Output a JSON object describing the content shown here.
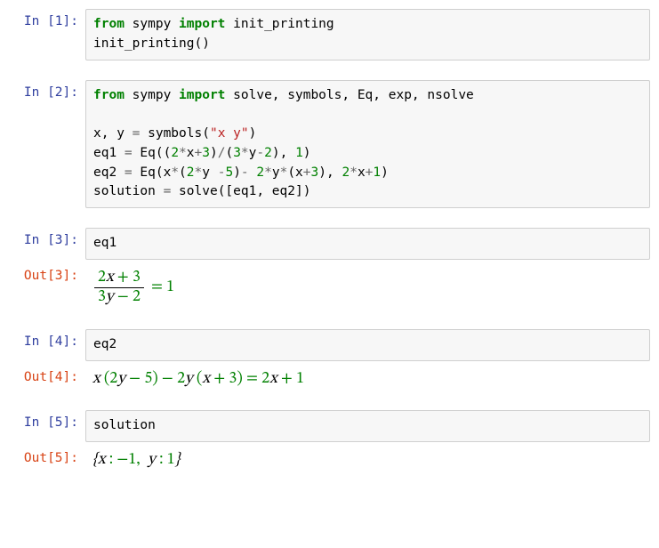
{
  "cells": [
    {
      "in_prompt": "In [1]:",
      "code": {
        "line1_from": "from",
        "line1_mod": " sympy ",
        "line1_import": "import",
        "line1_rest": " init_printing",
        "line2": "init_printing()"
      }
    },
    {
      "in_prompt": "In [2]:",
      "code": {
        "l1_from": "from",
        "l1_mod": " sympy ",
        "l1_import": "import",
        "l1_rest": " solve, symbols, Eq, exp, nsolve",
        "blank": "",
        "l3_a": "x, y ",
        "l3_eq": "=",
        "l3_b": " symbols(",
        "l3_str": "\"x y\"",
        "l3_c": ")",
        "l4_a": "eq1 ",
        "l4_eq": "=",
        "l4_b": " Eq((",
        "l4_n2a": "2",
        "l4_c": "*",
        "l4_d": "x",
        "l4_plus": "+",
        "l4_n3a": "3",
        "l4_e": ")",
        "l4_slash": "/",
        "l4_f": "(",
        "l4_n3b": "3",
        "l4_g": "*",
        "l4_h": "y",
        "l4_minus": "-",
        "l4_n2b": "2",
        "l4_i": "), ",
        "l4_n1": "1",
        "l4_j": ")",
        "l5_a": "eq2 ",
        "l5_eq": "=",
        "l5_b": " Eq(x",
        "l5_c": "*",
        "l5_d": "(",
        "l5_n2a": "2",
        "l5_e": "*",
        "l5_f": "y ",
        "l5_minus1": "-",
        "l5_n5": "5",
        "l5_g": ")",
        "l5_minus2": "-",
        "l5_h": " ",
        "l5_n2b": "2",
        "l5_i": "*",
        "l5_j": "y",
        "l5_k": "*",
        "l5_l": "(x",
        "l5_plus": "+",
        "l5_n3": "3",
        "l5_m": "), ",
        "l5_n2c": "2",
        "l5_n": "*",
        "l5_o": "x",
        "l5_plus2": "+",
        "l5_n1": "1",
        "l5_p": ")",
        "l6_a": "solution ",
        "l6_eq": "=",
        "l6_b": " solve([eq1, eq2])"
      }
    },
    {
      "in_prompt": "In [3]:",
      "code_plain": "eq1",
      "out_prompt": "Out[3]:",
      "out_math": {
        "frac_top_a": "2",
        "frac_top_b": "x",
        "frac_top_c": " + 3",
        "frac_bot_a": "3",
        "frac_bot_b": "y",
        "frac_bot_c": " − 2",
        "rest": " = 1"
      }
    },
    {
      "in_prompt": "In [4]:",
      "code_plain": "eq2",
      "out_prompt": "Out[4]:",
      "out_text_a": "x",
      "out_text_b": " (2",
      "out_text_c": "y",
      "out_text_d": " − 5) − 2",
      "out_text_e": "y",
      "out_text_f": " (",
      "out_text_g": "x",
      "out_text_h": " + 3) = 2",
      "out_text_i": "x",
      "out_text_j": " + 1"
    },
    {
      "in_prompt": "In [5]:",
      "code_plain": "solution",
      "out_prompt": "Out[5]:",
      "out_text": "{x : −1,  y : 1}"
    }
  ]
}
